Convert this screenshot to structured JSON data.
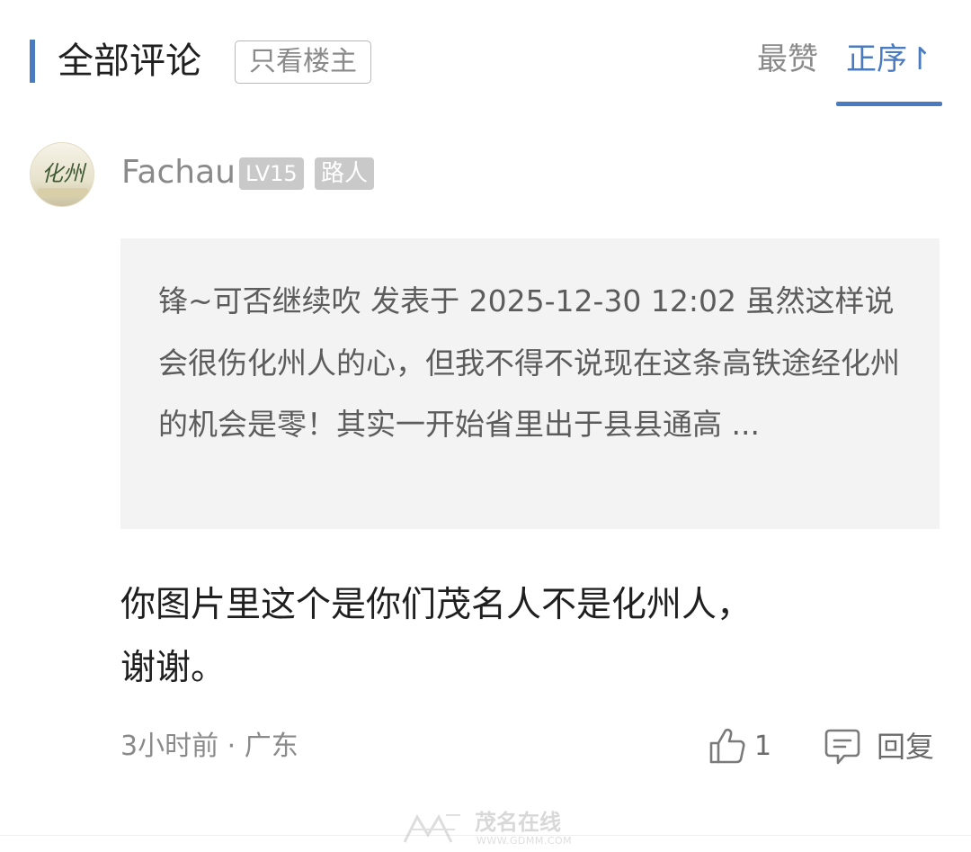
{
  "header": {
    "title": "全部评论",
    "filter_label": "只看楼主",
    "sort_likes": "最赞",
    "sort_asc": "正序↾"
  },
  "colors": {
    "accent": "#4a7bc0",
    "badge_bg": "#c9c9c9",
    "quote_bg": "#f3f3f3"
  },
  "comment": {
    "avatar_icon": "avatar-image",
    "avatar_text": "化州",
    "username": "Fachau",
    "level": "LV15",
    "role": "路人",
    "quote": "锋~可否继续吹 发表于 2025-12-30 12:02 虽然这样说会很伤化州人的心，但我不得不说现在这条高铁途经化州的机会是零！其实一开始省里出于县县通高 ...",
    "body": "你图片里这个是你们茂名人不是化州人，\n谢谢。",
    "meta": "3小时前 · 广东",
    "like_icon": "thumbs-up-icon",
    "like_count": "1",
    "reply_icon": "comment-icon",
    "reply_label": "回复"
  },
  "watermark": {
    "text": "茂名在线",
    "url": "WWW.GDMM.COM"
  }
}
